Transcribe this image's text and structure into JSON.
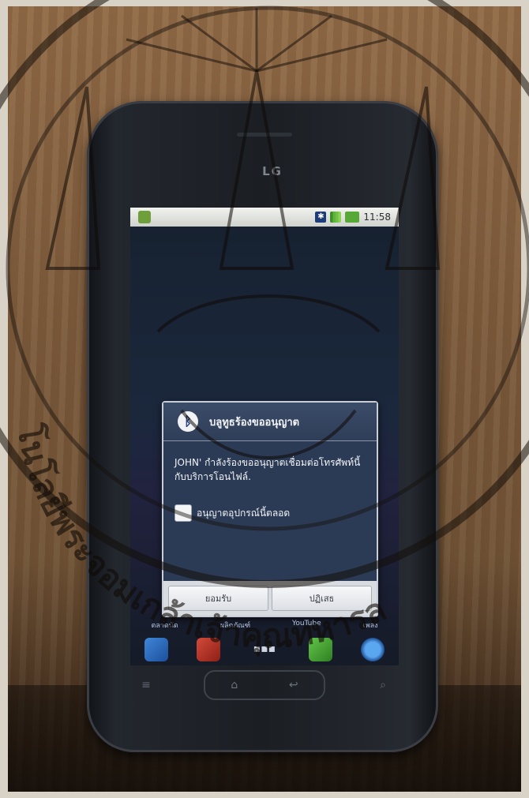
{
  "phone": {
    "brand": "LG",
    "status_time": "11:58",
    "status_icons": [
      "bluetooth-icon",
      "signal-icon",
      "battery-icon"
    ]
  },
  "dialog": {
    "icon": "bluetooth-icon",
    "title": "บลูทูธร้องขออนุญาต",
    "message": "JOHN' กำลังร้องขออนุญาตเชื่อมต่อโทรศัพท์นี้กับบริการโอนไฟล์.",
    "checkbox_label": "อนุญาตอุปกรณ์นี้ตลอด",
    "buttons": [
      "ยอมรับ",
      "ปฏิเสธ"
    ]
  },
  "home_labels": [
    "ตลาดนัด",
    "ผลิตภัณฑ์",
    "YouTube",
    "เพลง"
  ],
  "dock_icons": [
    "phone-icon",
    "contacts-icon",
    "apps-icon",
    "messaging-icon",
    "browser-icon"
  ],
  "hardware_keys": [
    "menu-icon",
    "home-icon",
    "back-icon",
    "search-icon"
  ],
  "watermark": {
    "text": "โนโลยีพระจอมเกล้าเจ้าคุณทหารล"
  }
}
